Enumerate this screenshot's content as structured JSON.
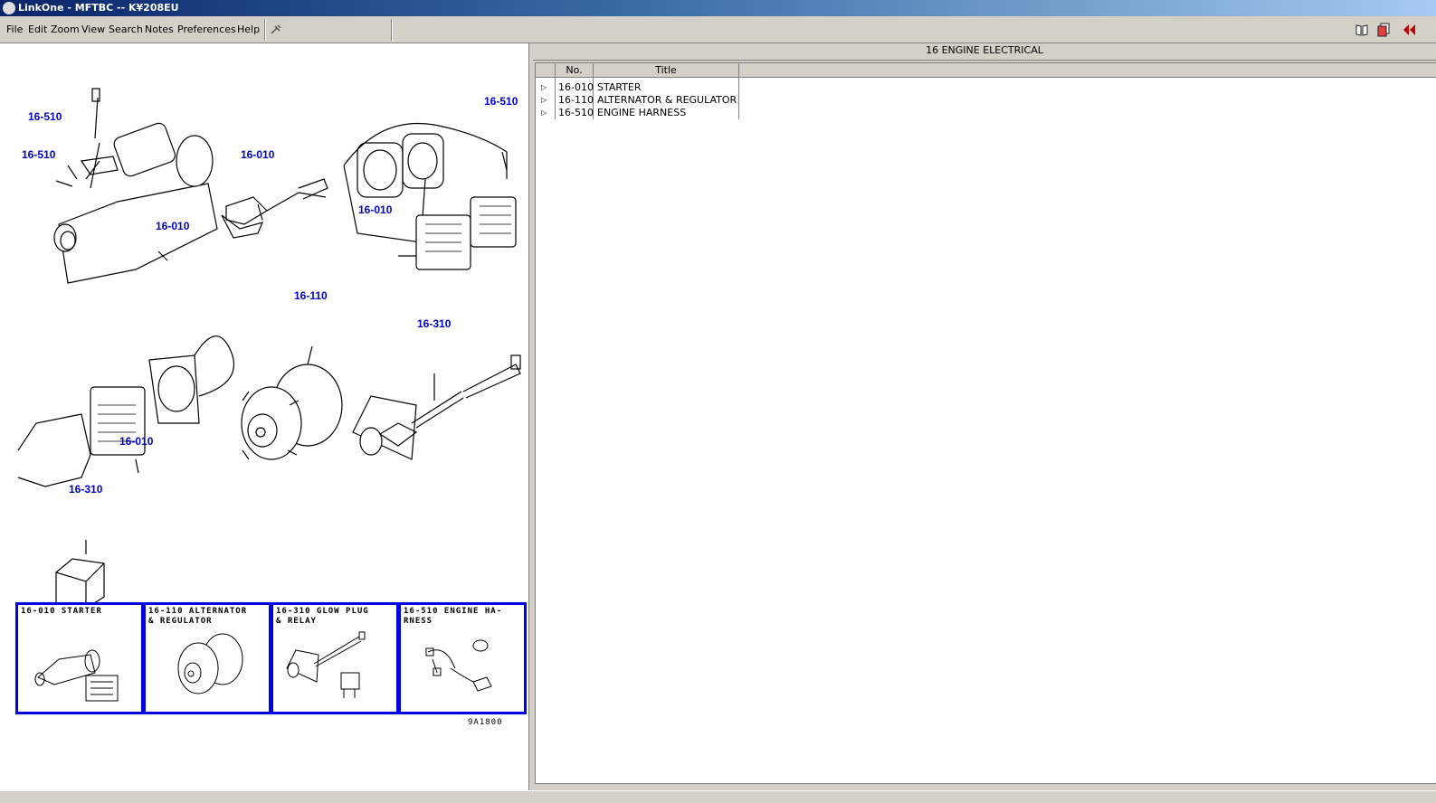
{
  "window": {
    "title": "LinkOne - MFTBC -- K¥208EU"
  },
  "menu": {
    "items": [
      "File",
      "Edit",
      "Zoom",
      "View",
      "Search",
      "Notes",
      "Preferences",
      "Help"
    ]
  },
  "diagram": {
    "callouts": [
      "16-510",
      "16-510",
      "16-010",
      "16-010",
      "16-510",
      "16-010",
      "16-110",
      "16-310",
      "16-010",
      "16-310"
    ],
    "thumbnails": [
      {
        "caption": "16-010 STARTER"
      },
      {
        "caption": "16-110 ALTERNATOR\n& REGULATOR"
      },
      {
        "caption": "16-310 GLOW PLUG\n& RELAY"
      },
      {
        "caption": "16-510 ENGINE HA-\nRNESS"
      }
    ],
    "figure_id": "9A1800"
  },
  "section": {
    "title": "16 ENGINE ELECTRICAL"
  },
  "table": {
    "headers": {
      "no": "No.",
      "title": "Title"
    },
    "rows": [
      {
        "no": "16-010",
        "title": "STARTER"
      },
      {
        "no": "16-110",
        "title": "ALTERNATOR & REGULATOR"
      },
      {
        "no": "16-510",
        "title": "ENGINE HARNESS"
      }
    ]
  }
}
